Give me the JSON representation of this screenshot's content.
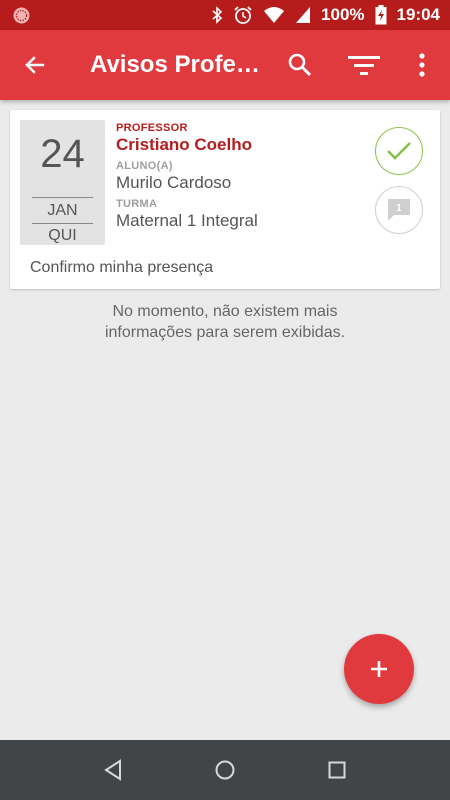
{
  "status_bar": {
    "battery": "100%",
    "time": "19:04"
  },
  "app_bar": {
    "title": "Avisos Profe…"
  },
  "notice": {
    "date": {
      "day": "24",
      "month": "JAN",
      "weekday": "QUI"
    },
    "professor_label": "PROFESSOR",
    "professor_name": "Cristiano Coelho",
    "student_label": "ALUNO(A)",
    "student_name": "Murilo Cardoso",
    "class_label": "TURMA",
    "class_name": "Maternal 1 Integral",
    "comment_count": "1",
    "message": "Confirmo minha presença"
  },
  "empty_message": {
    "line1": "No momento, não existem mais",
    "line2": "informações para serem exibidas."
  },
  "colors": {
    "status_bar": "#b71c1c",
    "app_bar": "#e03a3e",
    "accent_red": "#b71c1c",
    "confirm_green": "#8bc34a",
    "nav_bar": "#424548"
  },
  "icons": {
    "status_left": "app-notification-icon",
    "bluetooth": "bluetooth-icon",
    "alarm": "alarm-icon",
    "wifi": "wifi-icon",
    "signal": "signal-icon",
    "battery": "battery-charging-icon",
    "back": "arrow-back-icon",
    "search": "search-icon",
    "filter": "filter-icon",
    "more": "more-vert-icon",
    "check": "check-icon",
    "comment": "comment-icon",
    "add": "plus-icon",
    "nav_back": "triangle-back-icon",
    "nav_home": "circle-home-icon",
    "nav_recent": "square-recent-icon"
  }
}
